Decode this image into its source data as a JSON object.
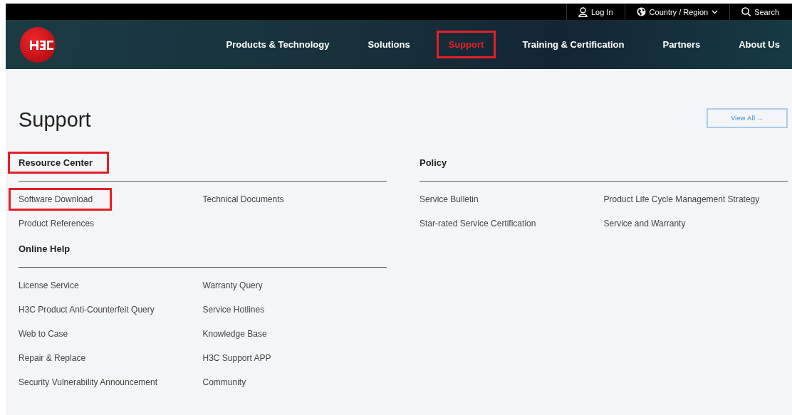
{
  "top_bar": {
    "login": "Log In",
    "region": "Country / Region",
    "search": "Search"
  },
  "nav": {
    "items": [
      {
        "label": "Products & Technology",
        "highlighted": false
      },
      {
        "label": "Solutions",
        "highlighted": false
      },
      {
        "label": "Support",
        "highlighted": true
      },
      {
        "label": "Training & Certification",
        "highlighted": false
      },
      {
        "label": "Partners",
        "highlighted": false
      },
      {
        "label": "About Us",
        "highlighted": false
      }
    ]
  },
  "page": {
    "title": "Support",
    "view_all": "View All →"
  },
  "left_column": [
    {
      "heading": "Resource Center",
      "highlighted": true,
      "links": [
        {
          "label": "Software Download",
          "highlighted": true
        },
        {
          "label": "Technical Documents",
          "highlighted": false
        },
        {
          "label": "Product References",
          "highlighted": false
        }
      ]
    },
    {
      "heading": "Online Help",
      "highlighted": false,
      "links": [
        {
          "label": "License Service",
          "highlighted": false
        },
        {
          "label": "Warranty Query",
          "highlighted": false
        },
        {
          "label": "H3C Product Anti-Counterfeit Query",
          "highlighted": false
        },
        {
          "label": "Service Hotlines",
          "highlighted": false
        },
        {
          "label": "Web to Case",
          "highlighted": false
        },
        {
          "label": "Knowledge Base",
          "highlighted": false
        },
        {
          "label": "Repair & Replace",
          "highlighted": false
        },
        {
          "label": "H3C Support APP",
          "highlighted": false
        },
        {
          "label": "Security Vulnerability Announcement",
          "highlighted": false
        },
        {
          "label": "Community",
          "highlighted": false
        }
      ]
    }
  ],
  "right_column": [
    {
      "heading": "Policy",
      "highlighted": false,
      "links": [
        {
          "label": "Service Bulletin",
          "highlighted": false
        },
        {
          "label": "Product Life Cycle Management Strategy",
          "highlighted": false
        },
        {
          "label": "Star-rated Service Certification",
          "highlighted": false
        },
        {
          "label": "Service and Warranty",
          "highlighted": false
        }
      ]
    }
  ]
}
